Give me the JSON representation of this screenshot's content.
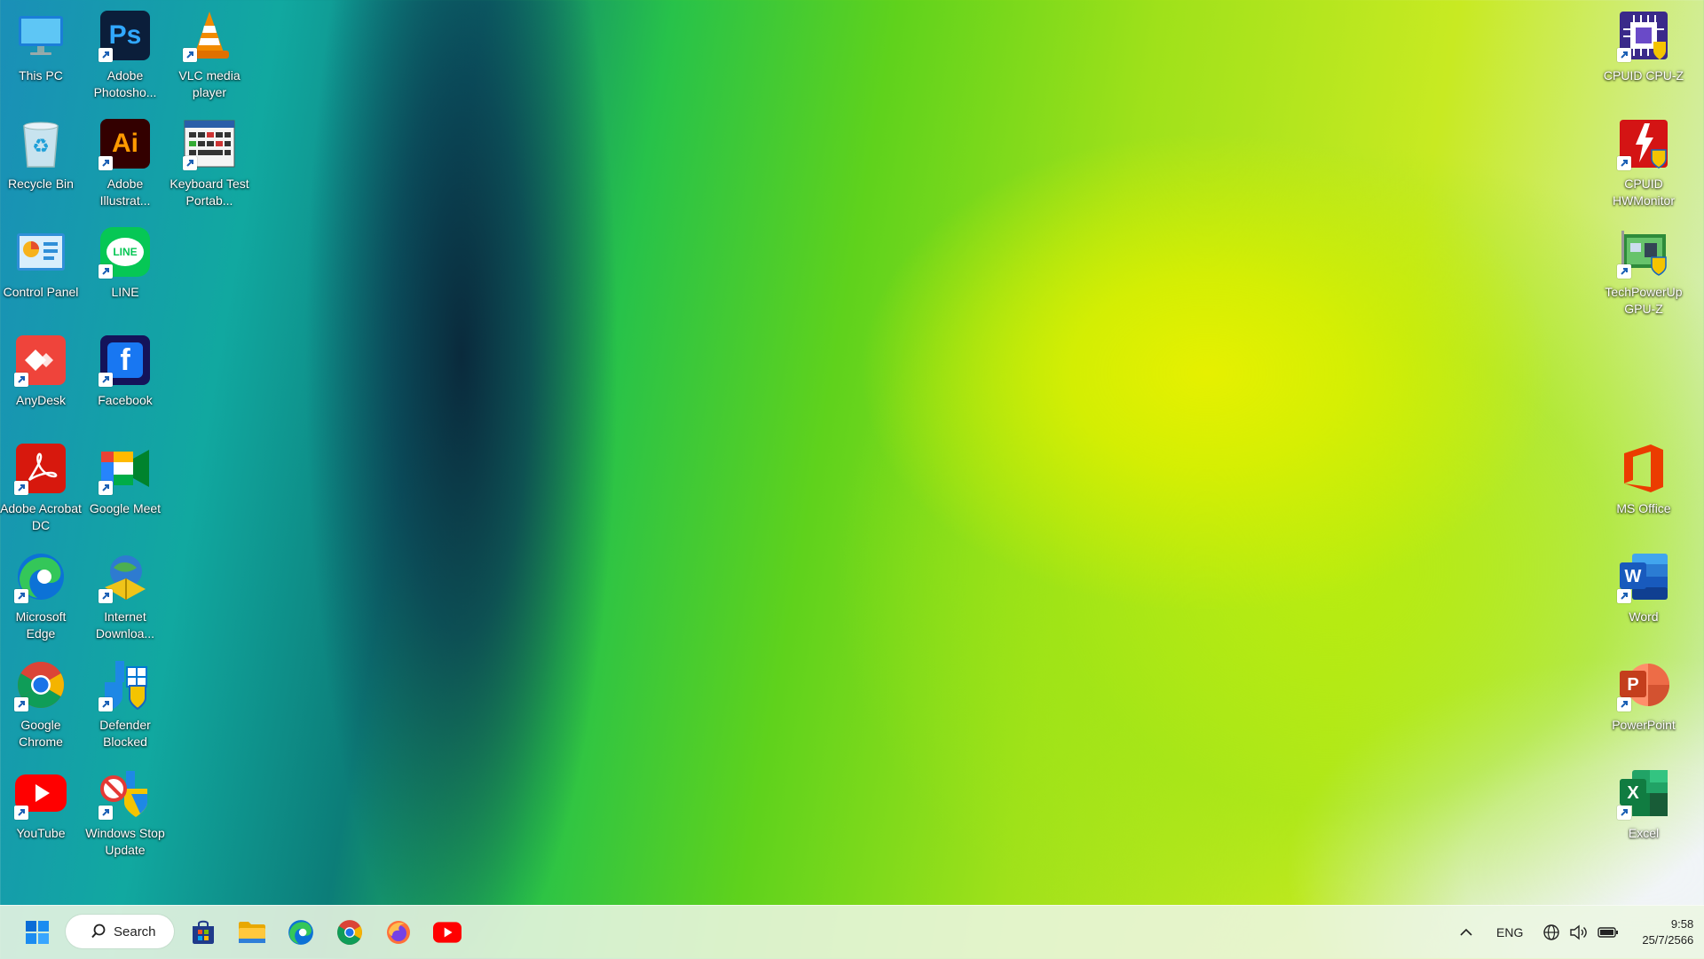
{
  "desktop": {
    "left_icons": [
      {
        "label": "This PC",
        "icon": "this-pc-icon"
      },
      {
        "label": "Adobe Photosho...",
        "icon": "photoshop-icon"
      },
      {
        "label": "VLC media player",
        "icon": "vlc-icon"
      },
      {
        "label": "Recycle Bin",
        "icon": "recycle-bin-icon"
      },
      {
        "label": "Adobe Illustrat...",
        "icon": "illustrator-icon"
      },
      {
        "label": "Keyboard Test Portab...",
        "icon": "keyboard-test-icon"
      },
      {
        "label": "Control Panel",
        "icon": "control-panel-icon"
      },
      {
        "label": "LINE",
        "icon": "line-icon"
      },
      {
        "label": "AnyDesk",
        "icon": "anydesk-icon"
      },
      {
        "label": "Facebook",
        "icon": "facebook-icon"
      },
      {
        "label": "Adobe Acrobat DC",
        "icon": "acrobat-icon"
      },
      {
        "label": "Google Meet",
        "icon": "google-meet-icon"
      },
      {
        "label": "Microsoft Edge",
        "icon": "edge-icon"
      },
      {
        "label": "Internet Downloa...",
        "icon": "idm-icon"
      },
      {
        "label": "Google Chrome",
        "icon": "chrome-icon"
      },
      {
        "label": "Defender Blocked",
        "icon": "defender-icon"
      },
      {
        "label": "YouTube",
        "icon": "youtube-icon"
      },
      {
        "label": "Windows Stop Update",
        "icon": "windows-stop-update-icon"
      }
    ],
    "right_icons": [
      {
        "label": "CPUID CPU-Z",
        "icon": "cpuz-icon"
      },
      {
        "label": "CPUID HWMonitor",
        "icon": "hwmonitor-icon"
      },
      {
        "label": "TechPowerUp GPU-Z",
        "icon": "gpuz-icon"
      },
      {
        "label": "MS Office",
        "icon": "ms-office-icon"
      },
      {
        "label": "Word",
        "icon": "word-icon"
      },
      {
        "label": "PowerPoint",
        "icon": "powerpoint-icon"
      },
      {
        "label": "Excel",
        "icon": "excel-icon"
      }
    ]
  },
  "taskbar": {
    "search_label": "Search",
    "pinned": [
      "start-icon",
      "store-icon",
      "file-explorer-icon",
      "edge-icon",
      "chrome-icon",
      "firefox-icon",
      "youtube-icon"
    ],
    "tray": {
      "language": "ENG",
      "time": "9:58",
      "date": "25/7/2566"
    }
  },
  "colors": {
    "wallpaper_green": "#7fd91a",
    "wallpaper_yellow": "#e6f000",
    "wallpaper_teal": "#0c7d78"
  }
}
